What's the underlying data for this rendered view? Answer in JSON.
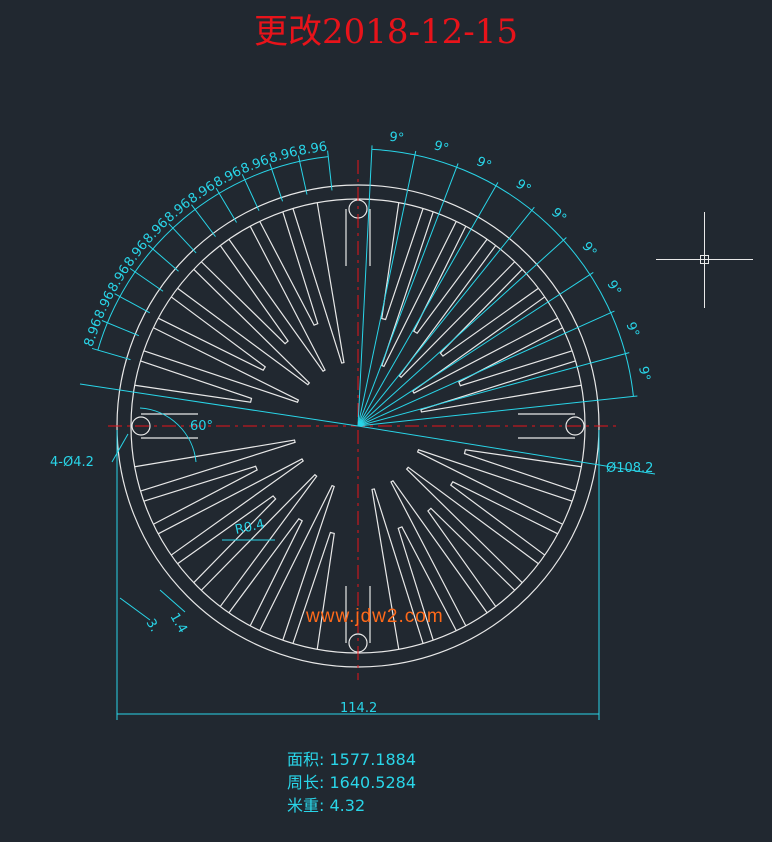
{
  "title": "更改2018-12-15",
  "colors": {
    "background": "#212830",
    "outline": "#e8e8e8",
    "dimension": "#29d5e8",
    "centerline": "#e8131a",
    "watermark": "#ff6a1a"
  },
  "dimensions": {
    "fin_spacing_left": [
      "8.96",
      "8.96",
      "8.96",
      "8.96",
      "8.96",
      "8.96",
      "8.96",
      "8.96",
      "8.96",
      "8.96",
      "8.96"
    ],
    "fin_angle_right": [
      "9°",
      "9°",
      "9°",
      "9°",
      "9°",
      "9°",
      "9°",
      "9°",
      "9°"
    ],
    "angle_60": "60°",
    "holes": "4-Ø4.2",
    "outer_diameter": "Ø108.2",
    "radius": "R0.4",
    "root_thickness": "1.4",
    "fin_thickness": "3.",
    "overall_width": "114.2"
  },
  "properties": [
    {
      "label": "面积:",
      "value": "1577.1884"
    },
    {
      "label": "周长:",
      "value": "1640.5284"
    },
    {
      "label": "米重:",
      "value": "4.32"
    }
  ],
  "watermark": "www.jdw2.com",
  "icons": {
    "cursor": "crosshair-cursor-icon"
  }
}
